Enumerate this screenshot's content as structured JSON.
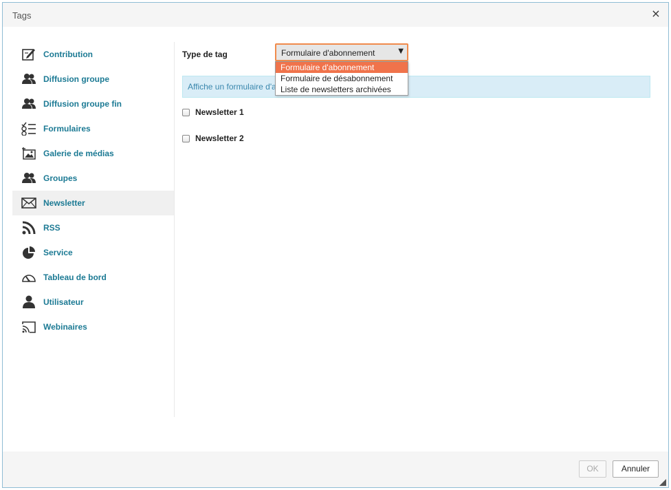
{
  "window": {
    "title": "Tags",
    "close_glyph": "×"
  },
  "sidebar": {
    "items": [
      {
        "label": "Contribution",
        "icon": "edit-icon"
      },
      {
        "label": "Diffusion groupe",
        "icon": "users-icon"
      },
      {
        "label": "Diffusion groupe fin",
        "icon": "users-icon"
      },
      {
        "label": "Formulaires",
        "icon": "form-list-icon"
      },
      {
        "label": "Galerie de médias",
        "icon": "media-gallery-icon"
      },
      {
        "label": "Groupes",
        "icon": "users-icon"
      },
      {
        "label": "Newsletter",
        "icon": "envelope-icon",
        "active": true
      },
      {
        "label": "RSS",
        "icon": "rss-icon"
      },
      {
        "label": "Service",
        "icon": "pie-chart-icon"
      },
      {
        "label": "Tableau de bord",
        "icon": "dashboard-gauge-icon"
      },
      {
        "label": "Utilisateur",
        "icon": "user-icon"
      },
      {
        "label": "Webinaires",
        "icon": "cast-icon"
      }
    ]
  },
  "main": {
    "type_label": "Type de tag",
    "select": {
      "value": "Formulaire d'abonnement",
      "arrow": "▼",
      "options": [
        "Formulaire d'abonnement",
        "Formulaire de désabonnement",
        "Liste de newsletters archivées"
      ],
      "selected_index": 0
    },
    "info": "Affiche un formulaire d'a",
    "newsletters": [
      {
        "label": "Newsletter 1",
        "checked": false
      },
      {
        "label": "Newsletter 2",
        "checked": false
      }
    ]
  },
  "footer": {
    "ok_label": "OK",
    "cancel_label": "Annuler"
  },
  "colors": {
    "accent": "#1c7a94",
    "select_border": "#f08a4b",
    "option_selected": "#f0734b",
    "info_bg": "#d9edf7",
    "info_text": "#3a87ad"
  }
}
